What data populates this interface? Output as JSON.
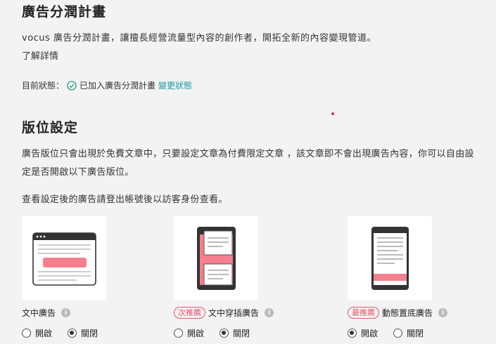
{
  "program": {
    "title": "廣告分潤計畫",
    "description": "vocus 廣告分潤計畫，讓擅長經營流量型內容的創作者，開拓全新的內容變現管道。",
    "learn_more": "了解詳情",
    "status_label": "目前狀態：",
    "status_value": "已加入廣告分潤計畫",
    "change_status": "變更狀態"
  },
  "placement": {
    "title": "版位設定",
    "paragraph": "廣告版位只會出現於免費文章中，只要設定文章為付費限定文章 ，該文章即不會出現廣告內容，你可以自由設定是否開啟以下廣告版位。",
    "note": "查看設定後的廣告請登出帳號後以訪客身份查看。"
  },
  "ads": [
    {
      "name": "文中廣告",
      "tag": "",
      "on_label": "開啟",
      "off_label": "關閉",
      "selected": "off"
    },
    {
      "name": "文中穿插廣告",
      "tag": "次推薦",
      "on_label": "開啟",
      "off_label": "關閉",
      "selected": "off"
    },
    {
      "name": "動態置底廣告",
      "tag": "最推薦",
      "on_label": "開啟",
      "off_label": "關閉",
      "selected": "on"
    }
  ],
  "colors": {
    "accent_teal": "#1a9aa8",
    "ad_pink": "#f57f8c",
    "tag_red": "#e05a6a"
  },
  "icons": {
    "status": "check-circle-icon",
    "info": "info-icon"
  }
}
